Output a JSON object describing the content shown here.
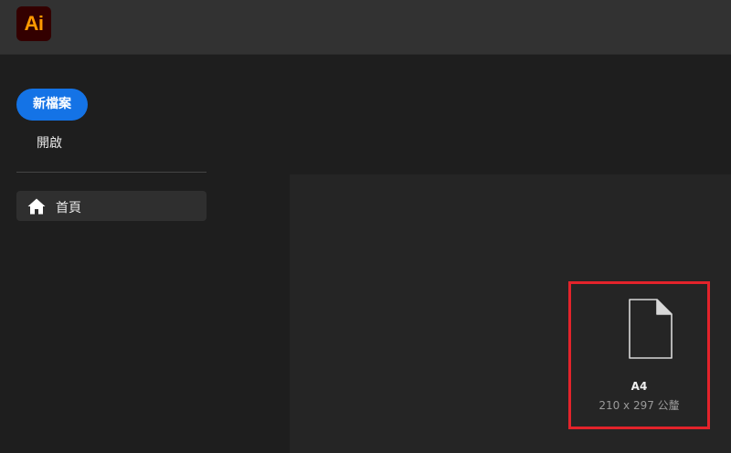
{
  "app": {
    "logo_text": "Ai",
    "logo_color": "#ff9a00",
    "logo_bg": "#330000"
  },
  "sidebar": {
    "new_button_label": "新檔案",
    "open_label": "開啟",
    "nav_items": [
      {
        "label": "首頁",
        "icon": "home-icon",
        "active": true
      }
    ]
  },
  "main": {
    "preset": {
      "name": "A4",
      "size": "210 x 297 公釐",
      "icon": "document-icon",
      "highlight_color": "#e3232b"
    }
  },
  "colors": {
    "accent": "#1473e6"
  }
}
